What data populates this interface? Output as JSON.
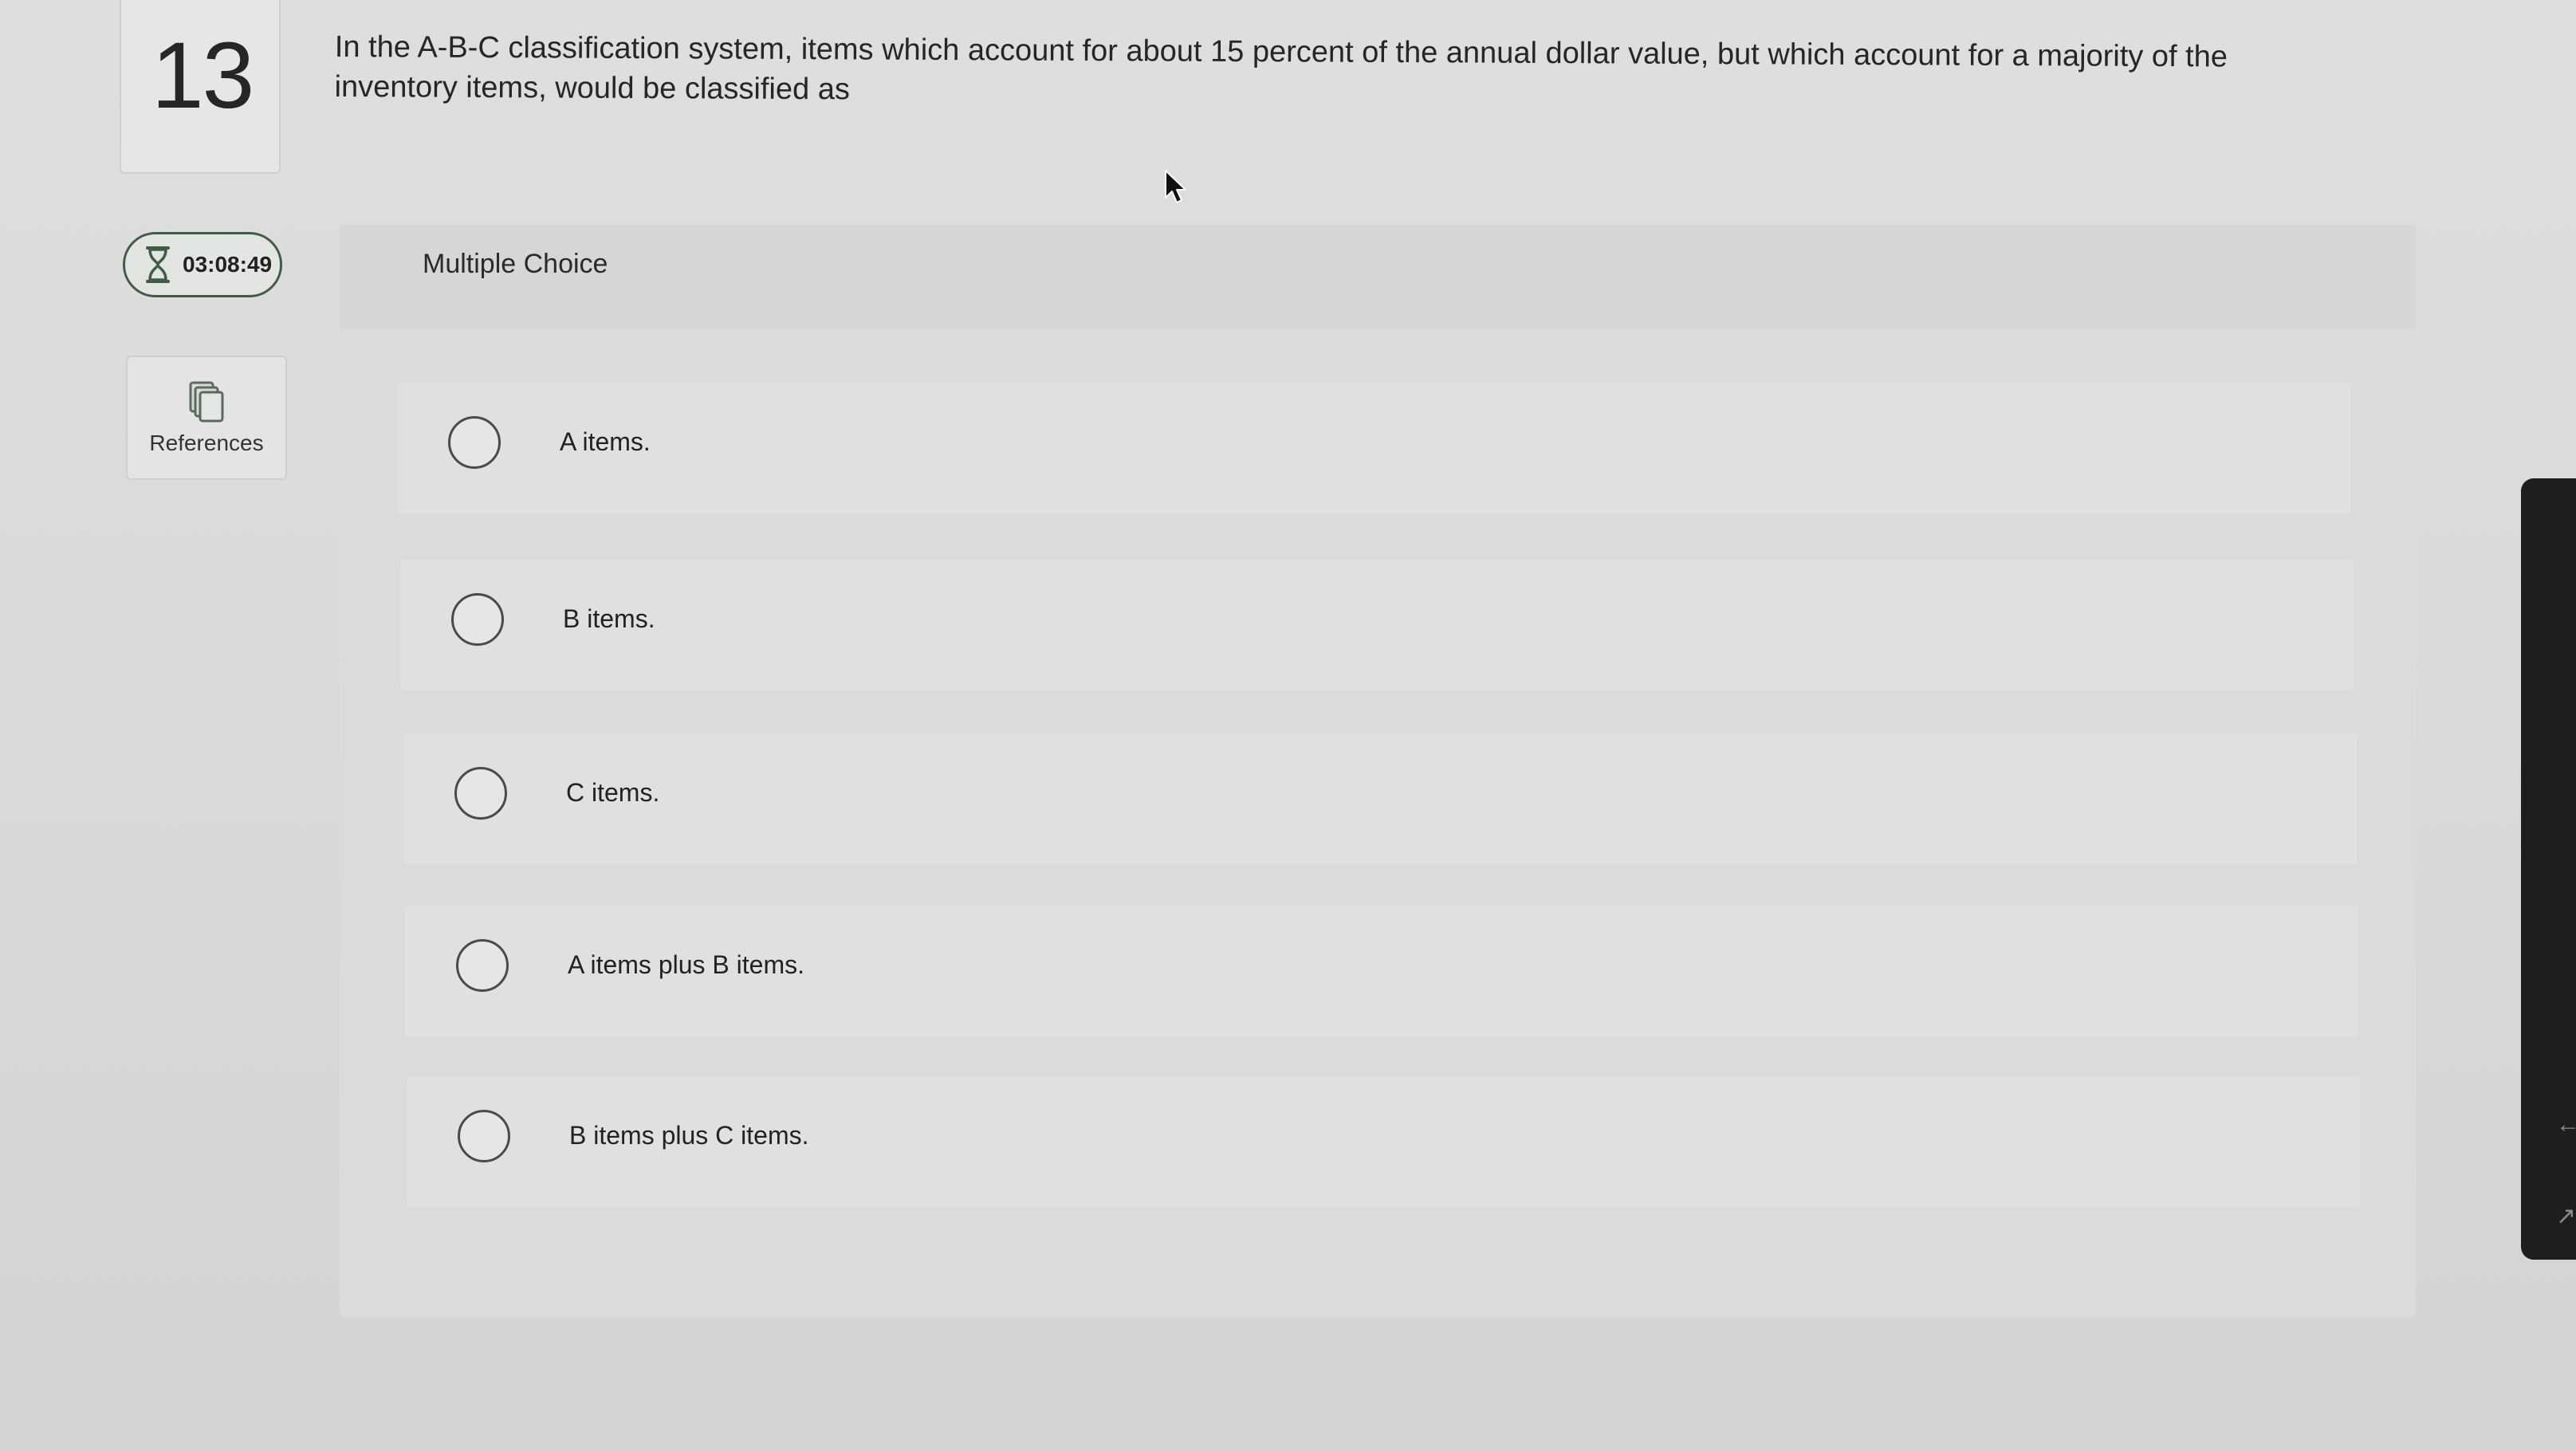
{
  "question": {
    "number": "13",
    "text": "In the A-B-C classification system, items which account for about 15 percent of the annual dollar value, but which account for a majority of the inventory items, would be classified as"
  },
  "timer": {
    "icon": "hourglass-icon",
    "value": "03:08:49"
  },
  "references": {
    "icon": "copy-pages-icon",
    "label": "References"
  },
  "panel": {
    "title": "Multiple Choice",
    "options": [
      {
        "label": "A items."
      },
      {
        "label": "B items."
      },
      {
        "label": "C items."
      },
      {
        "label": "A items plus B items."
      },
      {
        "label": "B items plus C items."
      }
    ]
  },
  "colors": {
    "background": "#dcdcdc",
    "timer_border": "#3f5d45",
    "text": "#262626"
  }
}
